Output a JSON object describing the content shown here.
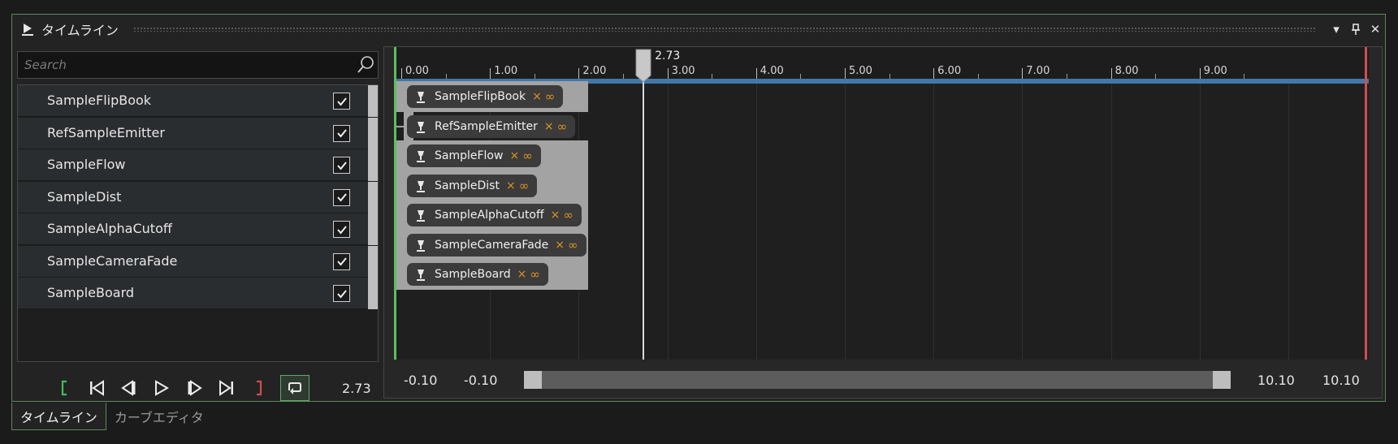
{
  "window": {
    "title": "タイムライン",
    "menu_icon": "dropdown-arrow-icon",
    "pin_icon": "pin-icon",
    "close_icon": "close-icon"
  },
  "search": {
    "placeholder": "Search",
    "value": ""
  },
  "tracks": [
    {
      "name": "SampleFlipBook",
      "checked": true
    },
    {
      "name": "RefSampleEmitter",
      "checked": true
    },
    {
      "name": "SampleFlow",
      "checked": true
    },
    {
      "name": "SampleDist",
      "checked": true
    },
    {
      "name": "SampleAlphaCutoff",
      "checked": true
    },
    {
      "name": "SampleCameraFade",
      "checked": true
    },
    {
      "name": "SampleBoard",
      "checked": true
    }
  ],
  "transport": {
    "current_time": "2.73",
    "buttons": [
      "range-start",
      "go-to-start",
      "step-back",
      "play",
      "step-forward",
      "go-to-end",
      "range-end",
      "loop"
    ]
  },
  "timeline": {
    "ruler_labels": [
      "0.00",
      "1.00",
      "2.00",
      "3.00",
      "4.00",
      "5.00",
      "6.00",
      "7.00",
      "8.00",
      "9.00"
    ],
    "playhead_label": "2.73",
    "playhead_time": 2.73,
    "clips": [
      {
        "label": "SampleFlipBook",
        "mark": "×",
        "loop": "∞"
      },
      {
        "label": "RefSampleEmitter",
        "mark": "×",
        "loop": "∞"
      },
      {
        "label": "SampleFlow",
        "mark": "×",
        "loop": "∞"
      },
      {
        "label": "SampleDist",
        "mark": "×",
        "loop": "∞"
      },
      {
        "label": "SampleAlphaCutoff",
        "mark": "×",
        "loop": "∞"
      },
      {
        "label": "SampleCameraFade",
        "mark": "×",
        "loop": "∞"
      },
      {
        "label": "SampleBoard",
        "mark": "×",
        "loop": "∞"
      }
    ]
  },
  "range": {
    "view_min": "-0.10",
    "range_min": "-0.10",
    "range_max": "10.10",
    "view_max": "10.10"
  },
  "tabs": [
    {
      "label": "タイムライン",
      "active": true
    },
    {
      "label": "カーブエディタ",
      "active": false
    }
  ],
  "colors": {
    "accent_green": "#5a8a5e",
    "ruler_blue": "#4178a8",
    "infinity_orange": "#e2921f",
    "end_red": "#d34d4d"
  }
}
